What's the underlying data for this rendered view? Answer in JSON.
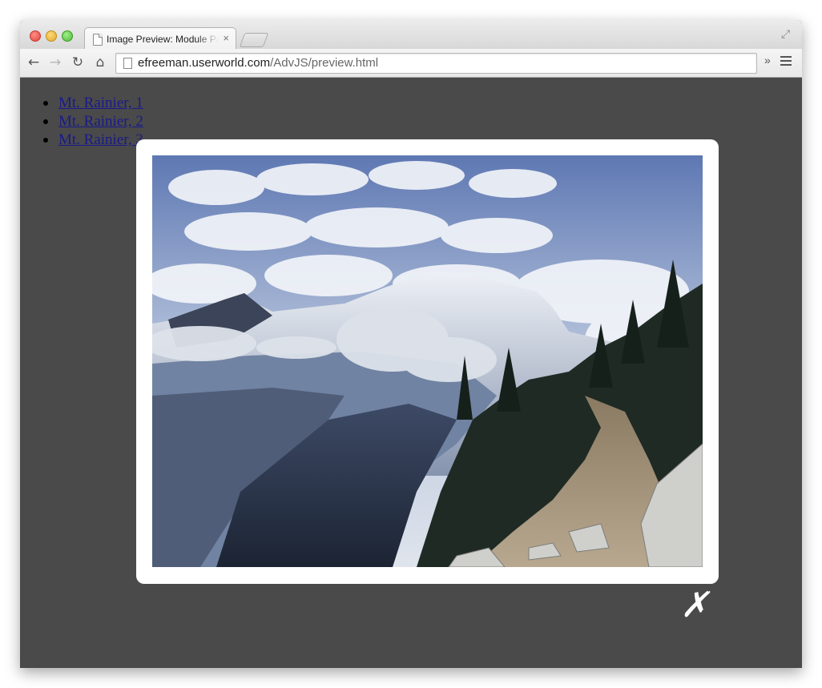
{
  "browser": {
    "tab_title": "Image Preview: Module Pattern",
    "tab_close": "×",
    "url_host": "efreeman.userworld.com",
    "url_path": "/AdvJS/preview.html",
    "back_icon": "←",
    "forward_icon": "→",
    "reload_icon": "↻",
    "home_icon": "⌂",
    "extensions_label": "»",
    "fullscreen_icon": "⤢"
  },
  "page": {
    "links": [
      {
        "label": "Mt. Rainier, 1"
      },
      {
        "label": "Mt. Rainier, 2"
      },
      {
        "label": "Mt. Rainier, 3"
      }
    ]
  },
  "preview": {
    "close_label": "✗",
    "image_description": "mountain-landscape-photo"
  },
  "colors": {
    "page_background": "#4a4a4a",
    "modal_background": "#ffffff",
    "link": "#1a1a8a"
  }
}
